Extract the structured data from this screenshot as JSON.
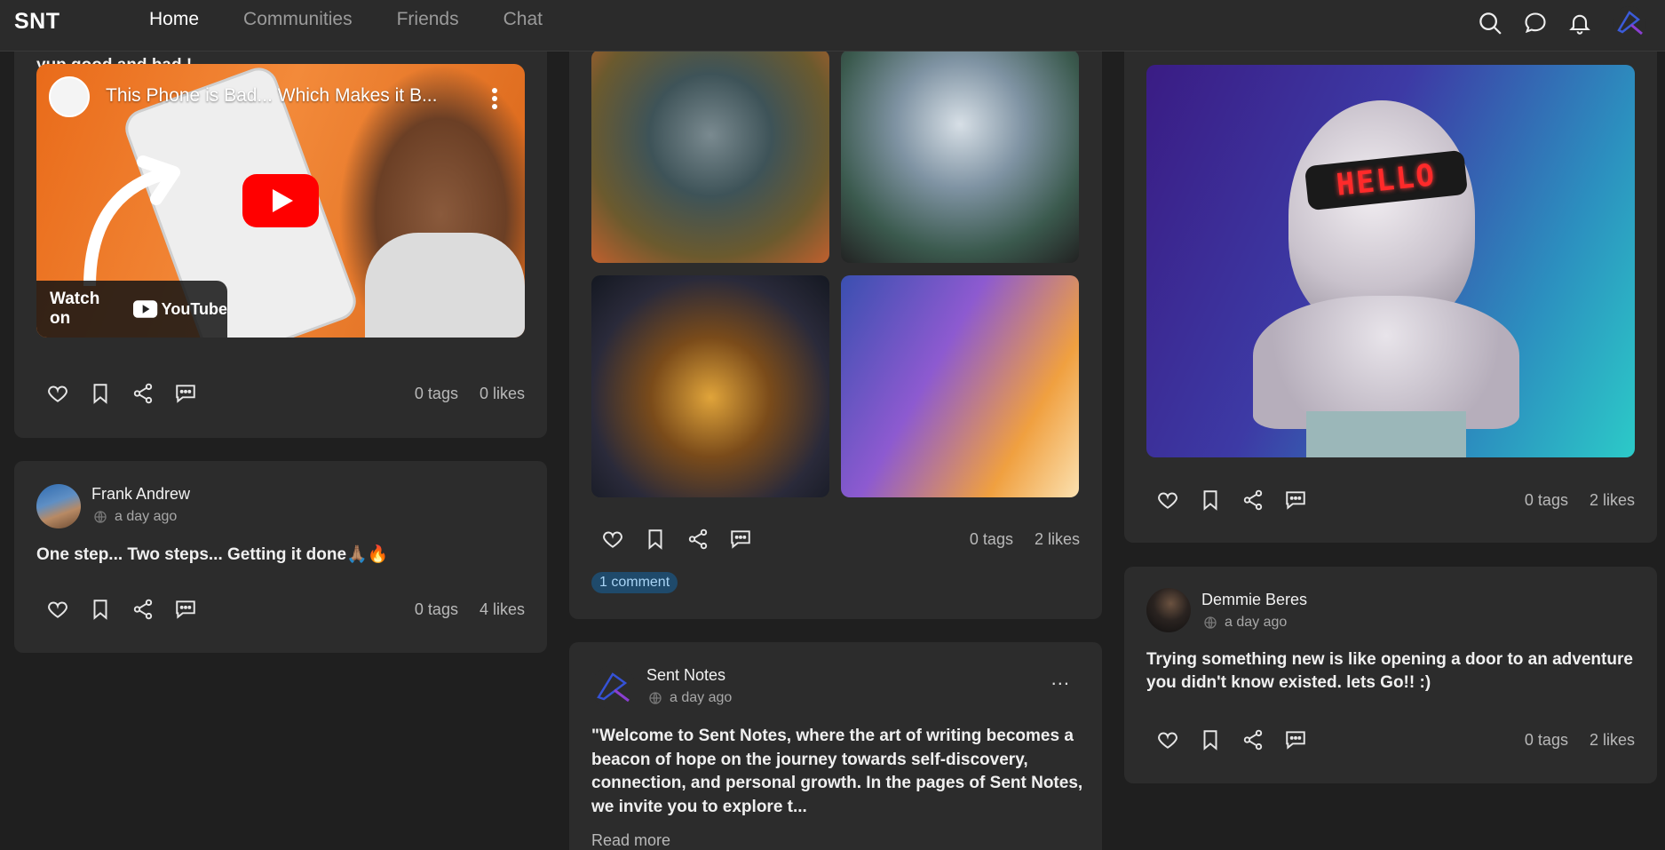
{
  "nav": {
    "logo": "SNT",
    "items": [
      "Home",
      "Communities",
      "Friends",
      "Chat"
    ],
    "active": "Home"
  },
  "colors": {
    "accent": "#1f4a6b",
    "bg": "#1f1f1f",
    "card": "#2c2c2c"
  },
  "posts": {
    "video_post": {
      "text": "yup good and bad !",
      "video_title": "This Phone is Bad... Which Makes it B...",
      "watch_on": "Watch on",
      "platform": "YouTube",
      "tags": "0 tags",
      "likes": "0 likes"
    },
    "frank_post": {
      "author": "Frank Andrew",
      "time": "a day ago",
      "text": "One step... Two steps... Getting it done🙏🏽🔥",
      "tags": "0 tags",
      "likes": "4 likes"
    },
    "robots_post": {
      "tags": "0 tags",
      "likes": "2 likes",
      "comments": "1 comment"
    },
    "sent_notes_post": {
      "author": "Sent Notes",
      "time": "a day ago",
      "more": "...",
      "text": "\"Welcome to Sent Notes, where the art of writing becomes a beacon of hope on the journey towards self-discovery, connection, and personal growth. In the pages of Sent Notes, we invite you to explore t...",
      "read_more": "Read more"
    },
    "bust_post": {
      "sign_text": "HELLO",
      "tags": "0 tags",
      "likes": "2 likes"
    },
    "demmie_post": {
      "author": "Demmie Beres",
      "time": "a day ago",
      "text": "Trying something new is like opening a door to an adventure you didn't know existed.  lets Go!! :)",
      "tags": "0 tags",
      "likes": "2 likes"
    }
  }
}
